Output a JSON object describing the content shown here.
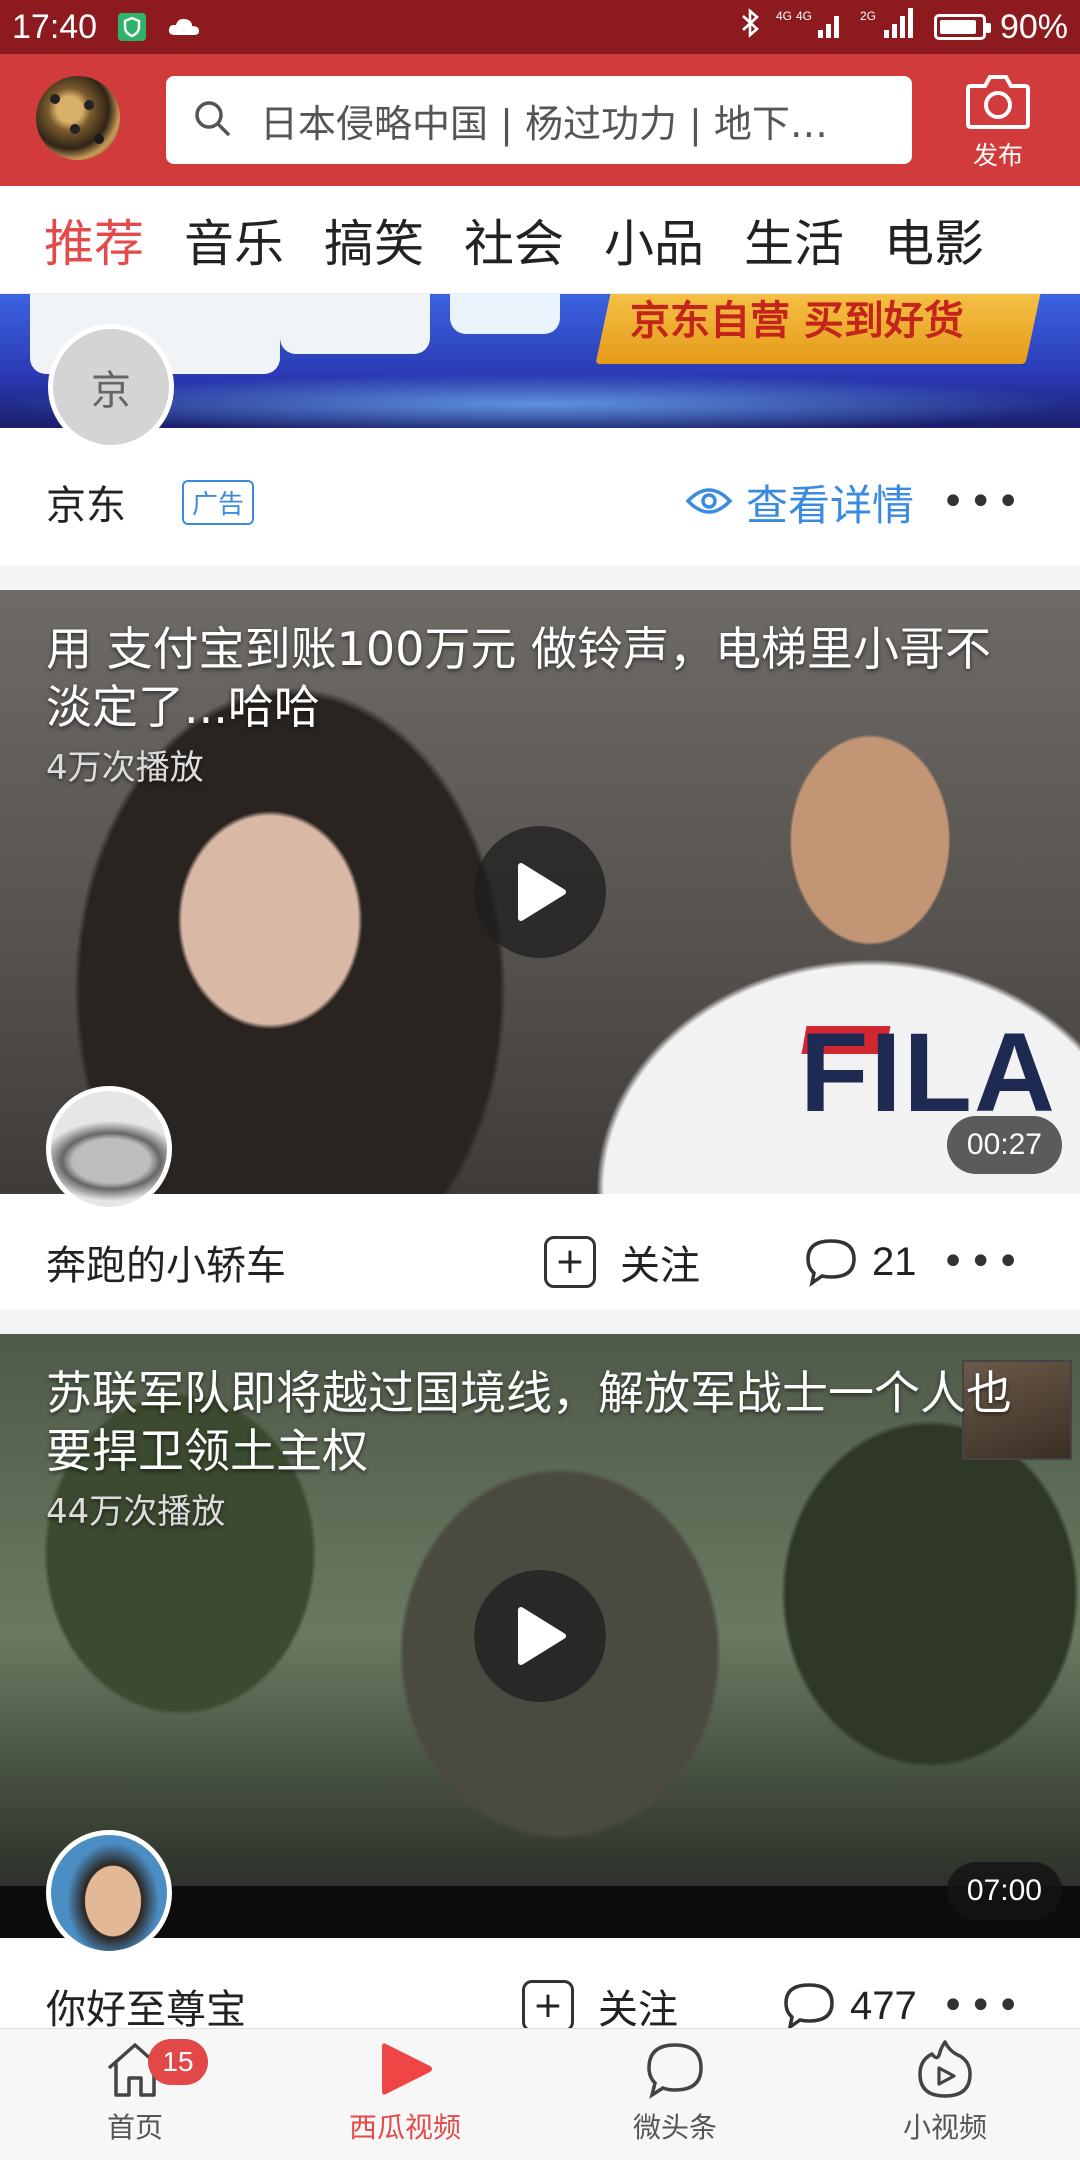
{
  "status_bar": {
    "time": "17:40",
    "battery": "90%",
    "battery_level": 0.9,
    "network_1": "4G",
    "network_2": "2G"
  },
  "header": {
    "search_placeholder": "日本侵略中国 | 杨过功力 | 地下…",
    "publish_label": "发布"
  },
  "tabs": [
    {
      "label": "推荐",
      "active": true
    },
    {
      "label": "音乐",
      "active": false
    },
    {
      "label": "搞笑",
      "active": false
    },
    {
      "label": "社会",
      "active": false
    },
    {
      "label": "小品",
      "active": false
    },
    {
      "label": "生活",
      "active": false
    },
    {
      "label": "电影",
      "active": false
    }
  ],
  "ad": {
    "banner_text": "京东自营  买到好货",
    "avatar_text": "京",
    "author": "京东",
    "tag": "广告",
    "detail_label": "查看详情"
  },
  "videos": [
    {
      "title": "用 支付宝到账100万元 做铃声，电梯里小哥不淡定了...哈哈",
      "plays": "4万次播放",
      "duration": "00:27",
      "shirt_text": "FILA",
      "author": "奔跑的小轿车",
      "follow_label": "关注",
      "comments": "21"
    },
    {
      "title": "苏联军队即将越过国境线，解放军战士一个人也要捍卫领土主权",
      "plays": "44万次播放",
      "duration": "07:00",
      "author": "你好至尊宝",
      "follow_label": "关注",
      "comments": "477"
    }
  ],
  "bottom_nav": [
    {
      "label": "首页",
      "icon": "home-icon",
      "badge": "15",
      "active": false
    },
    {
      "label": "西瓜视频",
      "icon": "play-icon",
      "active": true
    },
    {
      "label": "微头条",
      "icon": "chat-bubble-icon",
      "active": false
    },
    {
      "label": "小视频",
      "icon": "small-video-icon",
      "active": false
    }
  ],
  "colors": {
    "status_bar": "#8c1a1e",
    "header": "#d23b3b",
    "accent": "#e34a4a",
    "link_blue": "#3a8be0"
  }
}
